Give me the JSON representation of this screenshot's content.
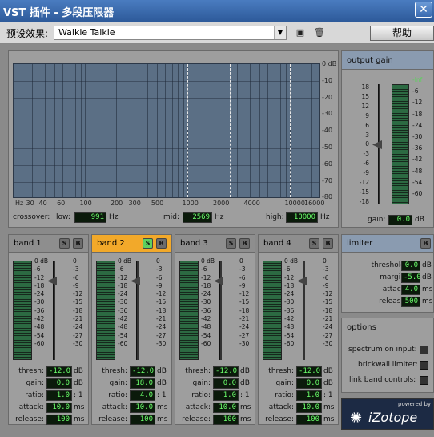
{
  "window": {
    "title": "VST 插件 - 多段压限器"
  },
  "preset": {
    "label": "预设效果:",
    "value": "Walkie Talkie"
  },
  "help": {
    "label": "帮助"
  },
  "spectrum": {
    "db_labels": [
      "0 dB",
      "-10",
      "-20",
      "-30",
      "-40",
      "-50",
      "-60",
      "-70",
      "-80"
    ],
    "hz_labels": [
      "Hz",
      "30",
      "40",
      "60",
      "100",
      "200",
      "300",
      "500",
      "1000",
      "2000",
      "4000",
      "10000",
      "16000"
    ]
  },
  "crossover": {
    "title": "crossover:",
    "low": {
      "label": "low:",
      "value": "991",
      "unit": "Hz"
    },
    "mid": {
      "label": "mid:",
      "value": "2569",
      "unit": "Hz"
    },
    "high": {
      "label": "high:",
      "value": "10000",
      "unit": "Hz"
    }
  },
  "meter_scale": [
    "0 dB",
    "-6",
    "-12",
    "-18",
    "-24",
    "-30",
    "-36",
    "-42",
    "-48",
    "-54",
    "-60"
  ],
  "right_scale": [
    "0",
    "-3",
    "-6",
    "-9",
    "-12",
    "-15",
    "-18",
    "-21",
    "-24",
    "-27",
    "-30"
  ],
  "params": {
    "thresh": "thresh:",
    "gain": "gain:",
    "ratio": "ratio:",
    "attack": "attack:",
    "release": "release:"
  },
  "bands": [
    {
      "name": "band 1",
      "active": false,
      "thresh": "-12.0",
      "gain": "0.0",
      "ratio": "1.0",
      "attack": "10.0",
      "release": "100"
    },
    {
      "name": "band 2",
      "active": true,
      "thresh": "-12.0",
      "gain": "18.0",
      "ratio": "4.0",
      "attack": "10.0",
      "release": "100"
    },
    {
      "name": "band 3",
      "active": false,
      "thresh": "-12.0",
      "gain": "0.0",
      "ratio": "1.0",
      "attack": "10.0",
      "release": "100"
    },
    {
      "name": "band 4",
      "active": false,
      "thresh": "-12.0",
      "gain": "0.0",
      "ratio": "1.0",
      "attack": "10.0",
      "release": "100"
    }
  ],
  "units": {
    "db": "dB",
    "ratio": ": 1",
    "ms": "ms"
  },
  "solo": "S",
  "bypass": "B",
  "output_gain": {
    "title": "output gain",
    "left_scale": [
      "18",
      "15",
      "12",
      "9",
      "6",
      "3",
      "0",
      "-3",
      "-6",
      "-9",
      "-12",
      "-15",
      "-18"
    ],
    "right_scale": [
      "-Inf",
      "-6",
      "-12",
      "-18",
      "-24",
      "-30",
      "-36",
      "-42",
      "-48",
      "-54",
      "-60"
    ],
    "gain_label": "gain:",
    "gain_value": "0.0",
    "gain_unit": "dB"
  },
  "limiter": {
    "title": "limiter",
    "bypass": "B",
    "threshold": {
      "label": "threshold:",
      "value": "0.0",
      "unit": "dB"
    },
    "margin": {
      "label": "margin:",
      "value": "-5.0",
      "unit": "dB"
    },
    "attack": {
      "label": "attack:",
      "value": "4.0",
      "unit": "ms"
    },
    "release": {
      "label": "release:",
      "value": "500",
      "unit": "ms"
    }
  },
  "options": {
    "title": "options",
    "spectrum": "spectrum on input:",
    "brickwall": "brickwall limiter:",
    "link": "link band controls:"
  },
  "logo": {
    "powered": "powered by",
    "brand": "iZotope"
  }
}
